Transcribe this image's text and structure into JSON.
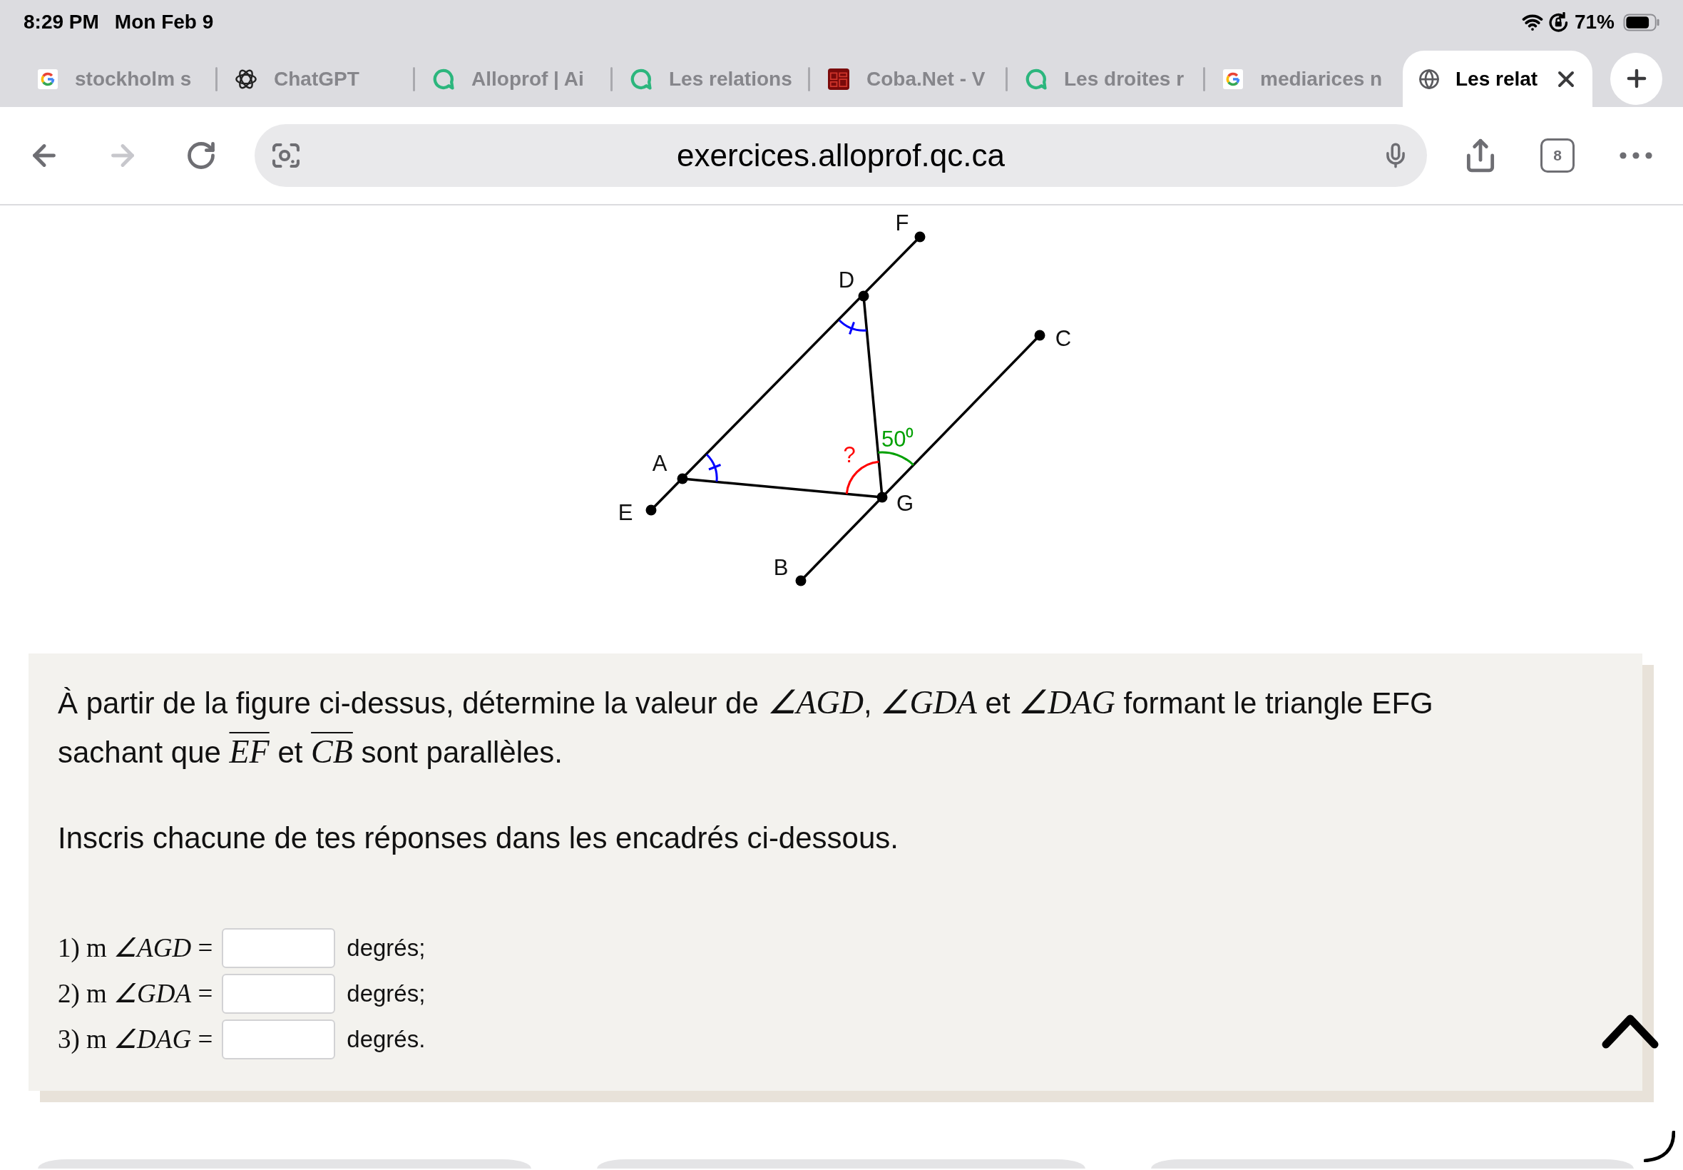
{
  "status_bar": {
    "time": "8:29 PM",
    "date": "Mon Feb 9",
    "battery": "71%"
  },
  "tabs": [
    {
      "kind": "g-logo",
      "label": "stockholm s",
      "selected": false
    },
    {
      "kind": "knot",
      "label": "ChatGPT",
      "selected": false
    },
    {
      "kind": "bubble",
      "label": "Alloprof | Ai",
      "selected": false
    },
    {
      "kind": "bubble",
      "label": "Les relations",
      "selected": false
    },
    {
      "kind": "tile",
      "label": "Coba.Net - V",
      "selected": false
    },
    {
      "kind": "bubble",
      "label": "Les droites r",
      "selected": false
    },
    {
      "kind": "g-logo",
      "label": "mediarices n",
      "selected": false
    },
    {
      "kind": "globe",
      "label": "Les relat",
      "selected": true
    }
  ],
  "toolbar": {
    "back": {
      "disabled": false
    },
    "forward": {
      "disabled": true
    },
    "url": "exercices.alloprof.qc.ca",
    "tab_count": "8"
  },
  "figure": {
    "points": [
      {
        "label": "F"
      },
      {
        "label": "D"
      },
      {
        "label": "C"
      },
      {
        "label": "A"
      },
      {
        "label": "E"
      },
      {
        "label": "G"
      },
      {
        "label": "B"
      }
    ],
    "angle_marks": [
      {
        "kind": "tick",
        "color": "#0000ff"
      },
      {
        "kind": "tick",
        "color": "#0000ff"
      },
      {
        "kind": "arc",
        "color": "#ff0000",
        "label": "?"
      },
      {
        "kind": "arc",
        "color": "#00a000",
        "label": "50⁰"
      }
    ]
  },
  "question": {
    "paragraphs": [
      [
        {
          "kind": "text",
          "text": "À partir de la figure ci-dessus, détermine la valeur de "
        },
        {
          "kind": "angle",
          "text": "∠AGD"
        },
        {
          "kind": "text",
          "text": ", "
        },
        {
          "kind": "angle",
          "text": "∠GDA"
        },
        {
          "kind": "text",
          "text": " et "
        },
        {
          "kind": "angle",
          "text": "∠DAG"
        },
        {
          "kind": "text",
          "text": " formant le triangle EFG sachant que "
        },
        {
          "kind": "segment",
          "text": "EF"
        },
        {
          "kind": "text",
          "text": " et "
        },
        {
          "kind": "segment",
          "text": "CB"
        },
        {
          "kind": "text",
          "text": " sont parallèles."
        }
      ],
      [
        {
          "kind": "text",
          "text": "Inscris chacune de tes réponses dans les encadrés ci-dessous."
        }
      ]
    ],
    "answers": [
      {
        "number": "1)",
        "measure": "m",
        "angle": "∠AGD",
        "sign": "=",
        "unit": "degrés;"
      },
      {
        "number": "2)",
        "measure": "m",
        "angle": "∠GDA",
        "sign": "=",
        "unit": "degrés;"
      },
      {
        "number": "3)",
        "measure": "m",
        "angle": "∠DAG",
        "sign": "=",
        "unit": "degrés."
      }
    ]
  }
}
